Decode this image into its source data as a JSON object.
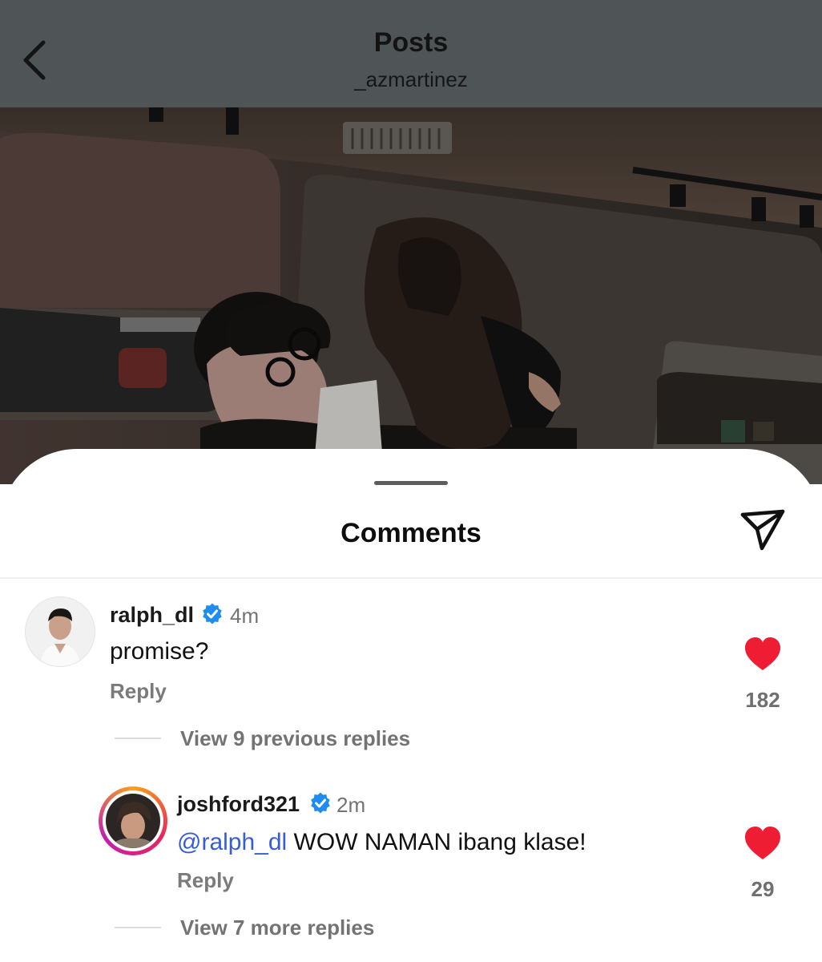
{
  "header": {
    "title": "Posts",
    "subtitle": "_azmartinez"
  },
  "photo": {
    "description_icon": "post-photo"
  },
  "sheet": {
    "title": "Comments"
  },
  "comments": [
    {
      "username": "ralph_dl",
      "verified": true,
      "time": "4m",
      "text": "promise?",
      "reply_label": "Reply",
      "likes": "182",
      "view_replies": "View 9 previous replies"
    },
    {
      "username": "joshford321",
      "verified": true,
      "time": "2m",
      "mention": "@ralph_dl",
      "text": " WOW NAMAN ibang klase!",
      "reply_label": "Reply",
      "likes": "29",
      "view_replies": "View 7 more replies"
    }
  ],
  "colors": {
    "header_bg": "#4f5457",
    "like_red": "#ee1d34",
    "verified_blue": "#1f8cf0",
    "mention_blue": "#385bd6"
  }
}
